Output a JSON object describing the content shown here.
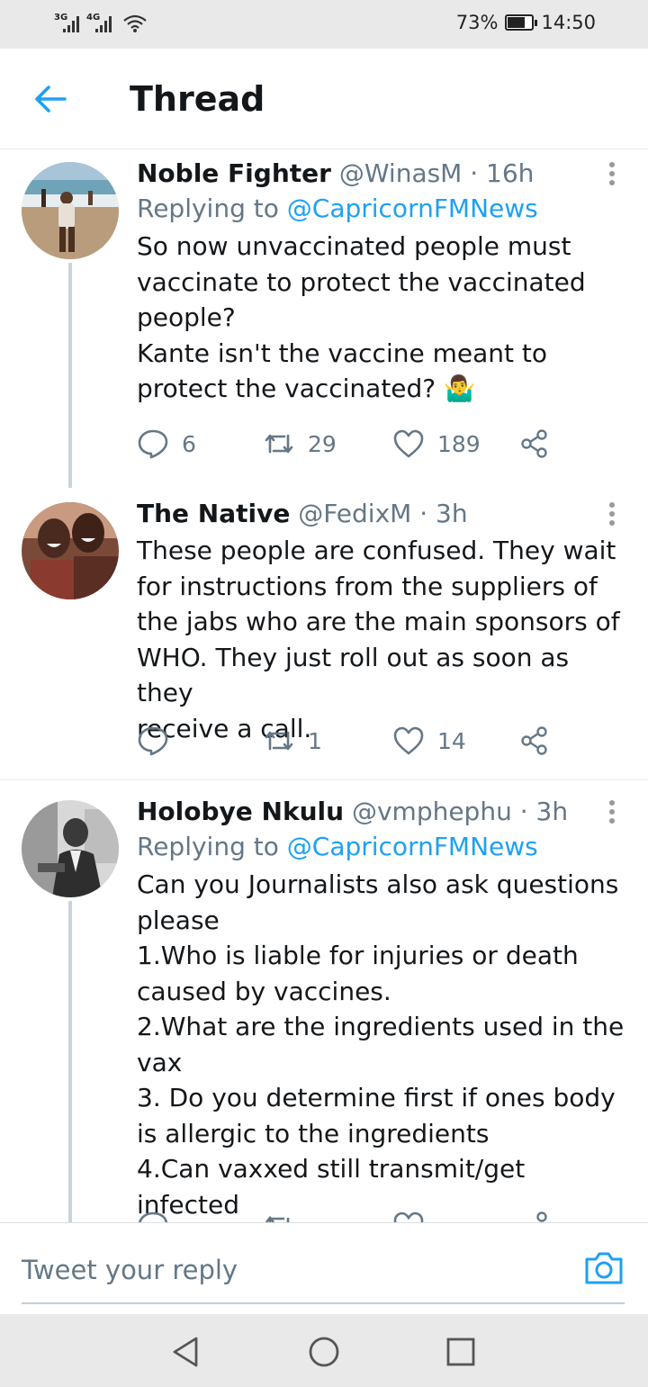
{
  "status_bar": {
    "network1": "3G",
    "network2": "4G",
    "battery": "73%",
    "battery_level": 0.73,
    "time": "14:50"
  },
  "header": {
    "title": "Thread",
    "back_icon": "arrow-left-icon"
  },
  "tweets": [
    {
      "name": "Noble Fighter",
      "handle": "@WinasM",
      "time": "· 16h",
      "replying_prefix": "Replying to ",
      "replying_to": "@CapricornFMNews",
      "text": "So now unvaccinated people must\nvaccinate to protect the vaccinated\npeople?\nKante isn't the vaccine meant to\nprotect the vaccinated? 🤷‍♂️",
      "replies": "6",
      "retweets": "29",
      "likes": "189"
    },
    {
      "name": "The Native",
      "handle": "@FedixM",
      "time": "· 3h",
      "text": "These people are confused. They wait\nfor instructions from the suppliers of\nthe jabs who are the main sponsors of\nWHO. They just roll out as soon as they\nreceive a call.",
      "replies": "",
      "retweets": "1",
      "likes": "14"
    },
    {
      "name": "Holobye Nkulu",
      "handle": "@vmphephu",
      "time": "· 3h",
      "replying_prefix": "Replying to ",
      "replying_to": "@CapricornFMNews",
      "text": "Can you Journalists also ask questions\nplease\n1.Who is liable for injuries or death\ncaused by vaccines.\n2.What are the ingredients used in the\nvax\n3. Do you determine first if ones body\nis allergic to the ingredients\n4.Can vaxxed still transmit/get infected"
    }
  ],
  "reply_bar": {
    "placeholder": "Tweet your reply",
    "camera_icon": "camera-icon"
  },
  "colors": {
    "accent": "#1da1f2",
    "secondary_text": "#657786",
    "primary_text": "#14171a"
  }
}
